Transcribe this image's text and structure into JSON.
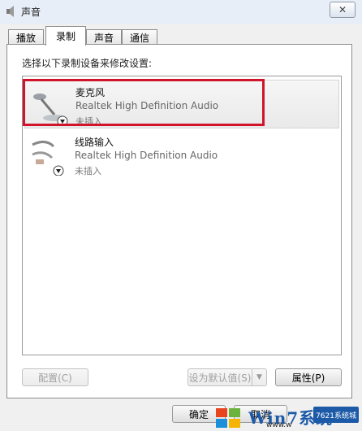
{
  "window": {
    "title": "声音",
    "close_symbol": "✕"
  },
  "tabs": [
    {
      "label": "播放"
    },
    {
      "label": "录制"
    },
    {
      "label": "声音"
    },
    {
      "label": "通信"
    }
  ],
  "instruction": "选择以下录制设备来修改设置:",
  "devices": [
    {
      "name": "麦克风",
      "driver": "Realtek High Definition Audio",
      "status": "未插入"
    },
    {
      "name": "线路输入",
      "driver": "Realtek High Definition Audio",
      "status": "未插入"
    }
  ],
  "buttons": {
    "configure": "配置(C)",
    "set_default": "设为默认值(S)",
    "properties": "属性(P)",
    "ok": "确定",
    "cancel": "取消"
  },
  "watermark": {
    "brand": "Win7系统",
    "site": "www.w",
    "corner": "7621系统城"
  },
  "colors": {
    "highlight": "#d0142c",
    "titlebar": "#e7eef7"
  }
}
